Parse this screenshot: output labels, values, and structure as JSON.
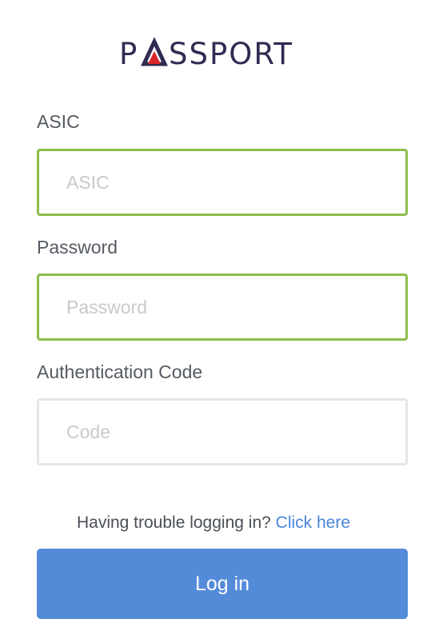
{
  "brand": {
    "name": "PASSPORT",
    "primary_color": "#2e2c52",
    "accent_color": "#d8262a"
  },
  "form": {
    "asic": {
      "label": "ASIC",
      "placeholder": "ASIC",
      "value": "",
      "state": "valid"
    },
    "password": {
      "label": "Password",
      "placeholder": "Password",
      "value": "",
      "state": "valid"
    },
    "code": {
      "label": "Authentication Code",
      "placeholder": "Code",
      "value": "",
      "state": "neutral"
    }
  },
  "help": {
    "text": "Having trouble logging in?",
    "link_label": "Click here"
  },
  "submit": {
    "label": "Log in",
    "color": "#548bd9"
  },
  "colors": {
    "valid_border": "#8cbd4b",
    "neutral_border": "#e6e6e6",
    "link": "#4a86d9"
  }
}
